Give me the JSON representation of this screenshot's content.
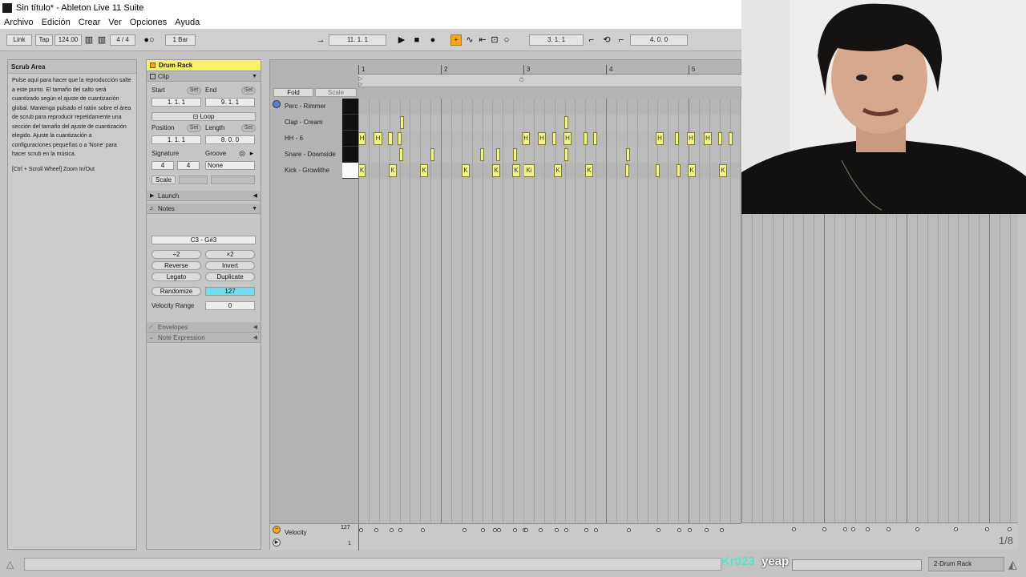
{
  "window": {
    "title": "Sin título* - Ableton Live 11 Suite"
  },
  "menu": [
    "Archivo",
    "Edición",
    "Crear",
    "Ver",
    "Opciones",
    "Ayuda"
  ],
  "controlbar": {
    "link": "Link",
    "tap": "Tap",
    "tempo": "124.00",
    "signature": "4 / 4",
    "quantize": "1 Bar",
    "arrangement_position": "11. 1. 1",
    "loop_start": "3. 1. 1",
    "loop_length": "4. 0. 0"
  },
  "info": {
    "title": "Scrub Area",
    "body": "Pulse aquí para hacer que la reproducción salte a este punto. El tamaño del salto será cuantizado según el ajuste de cuantización global. Mantenga pulsado el ratón sobre el área de scrub para reproducir repetidamente una sección del tamaño del ajuste de cuantización elegido. Ajuste la cuantización a configuraciones pequeñas o a 'None' para hacer scrub en la música.",
    "shortcut": "[Ctrl + Scroll Wheel] Zoom In/Out"
  },
  "clip": {
    "device_name": "Drum Rack",
    "section_clip": "Clip",
    "start_label": "Start",
    "end_label": "End",
    "set_label": "Set",
    "start_value": "1. 1. 1",
    "end_value": "9. 1. 1",
    "loop_label": "Loop",
    "position_label": "Position",
    "length_label": "Length",
    "position_value": "1. 1. 1",
    "length_value": "8. 0. 0",
    "signature_label": "Signature",
    "groove_label": "Groove",
    "sig_num": "4",
    "sig_den": "4",
    "groove_value": "None",
    "scale_label": "Scale",
    "section_launch": "Launch",
    "section_notes": "Notes",
    "note_range": "C3 - G#3",
    "half_label": "÷2",
    "double_label": "×2",
    "reverse_label": "Reverse",
    "invert_label": "Invert",
    "legato_label": "Legato",
    "duplicate_label": "Duplicate",
    "randomize_label": "Randomize",
    "randomize_value": "127",
    "velocity_range_label": "Velocity Range",
    "velocity_range_value": "0",
    "section_envelopes": "Envelopes",
    "section_expression": "Note Expression"
  },
  "editor": {
    "fold_label": "Fold",
    "scale_label": "Scale",
    "ruler": [
      "1",
      "2",
      "3",
      "4",
      "5"
    ],
    "lanes": [
      "Perc - Rimmer",
      "Clap - Cream",
      "HH - 6",
      "Snare - Downside",
      "Kick - Growlithe"
    ],
    "velocity_label": "Velocity",
    "velocity_max": "127",
    "velocity_min": "1",
    "grid_fraction": "1/8"
  },
  "overlay": {
    "name": "Kr023",
    "message": "yeap"
  },
  "status": {
    "device": "2-Drum Rack"
  },
  "colors": {
    "note": "#f1f28b",
    "playhead": "#6ec9d0",
    "device_header": "#f5f26a",
    "randomize": "#6fdcf2",
    "loop_button": "#f7a51d"
  }
}
